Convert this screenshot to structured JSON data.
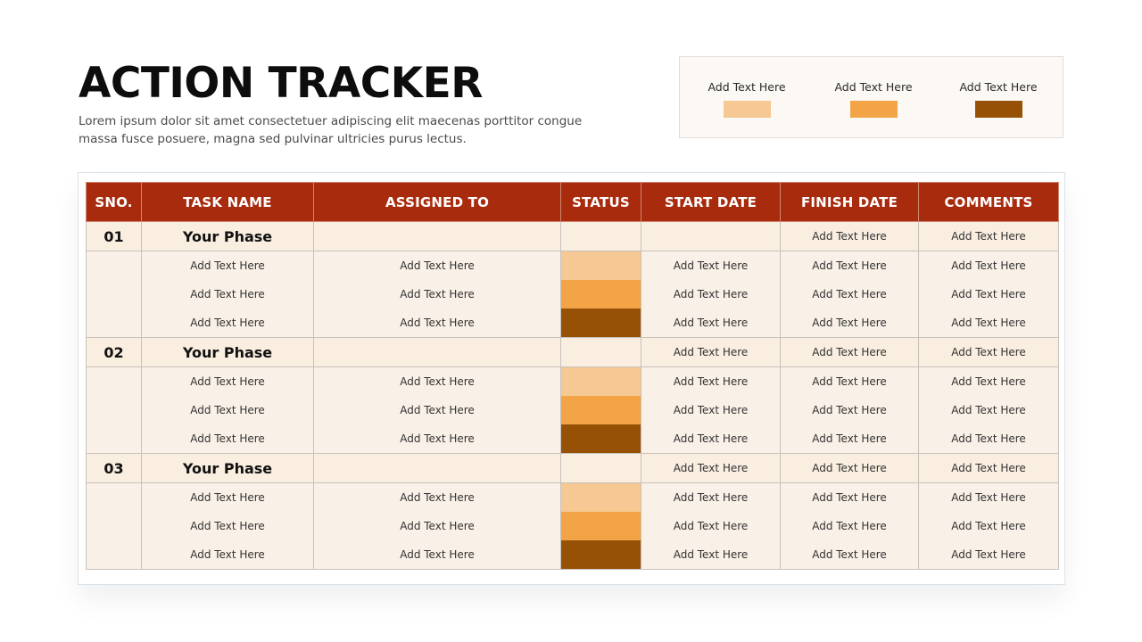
{
  "header": {
    "title": "ACTION TRACKER",
    "subtitle": "Lorem ipsum dolor sit amet consectetuer adipiscing elit maecenas porttitor congue massa fusce posuere, magna sed pulvinar ultricies purus lectus."
  },
  "legend": [
    {
      "label": "Add Text Here",
      "color": "#f6c893"
    },
    {
      "label": "Add Text Here",
      "color": "#f2a446"
    },
    {
      "label": "Add Text Here",
      "color": "#965107"
    }
  ],
  "table": {
    "headers": [
      "SNO.",
      "TASK NAME",
      "ASSIGNED TO",
      "STATUS",
      "START DATE",
      "FINISH DATE",
      "COMMENTS"
    ],
    "phases": [
      {
        "sno": "01",
        "name": "Your Phase",
        "start": "",
        "finish": "Add Text Here",
        "comments": "Add Text Here",
        "tasks": [
          {
            "task": "Add Text Here",
            "assigned": "Add Text Here",
            "status_color": "#f6c893",
            "start": "Add Text Here",
            "finish": "Add Text Here",
            "comments": "Add Text Here"
          },
          {
            "task": "Add Text Here",
            "assigned": "Add Text Here",
            "status_color": "#f2a446",
            "start": "Add Text Here",
            "finish": "Add Text Here",
            "comments": "Add Text Here"
          },
          {
            "task": "Add Text Here",
            "assigned": "Add Text Here",
            "status_color": "#965107",
            "start": "Add Text Here",
            "finish": "Add Text Here",
            "comments": "Add Text Here"
          }
        ]
      },
      {
        "sno": "02",
        "name": "Your Phase",
        "start": "Add Text Here",
        "finish": "Add Text Here",
        "comments": "Add Text Here",
        "tasks": [
          {
            "task": "Add Text Here",
            "assigned": "Add Text Here",
            "status_color": "#f6c893",
            "start": "Add Text Here",
            "finish": "Add Text Here",
            "comments": "Add Text Here"
          },
          {
            "task": "Add Text Here",
            "assigned": "Add Text Here",
            "status_color": "#f2a446",
            "start": "Add Text Here",
            "finish": "Add Text Here",
            "comments": "Add Text Here"
          },
          {
            "task": "Add Text Here",
            "assigned": "Add Text Here",
            "status_color": "#965107",
            "start": "Add Text Here",
            "finish": "Add Text Here",
            "comments": "Add Text Here"
          }
        ]
      },
      {
        "sno": "03",
        "name": "Your Phase",
        "start": "Add Text Here",
        "finish": "Add Text Here",
        "comments": "Add Text Here",
        "tasks": [
          {
            "task": "Add Text Here",
            "assigned": "Add Text Here",
            "status_color": "#f6c893",
            "start": "Add Text Here",
            "finish": "Add Text Here",
            "comments": "Add Text Here"
          },
          {
            "task": "Add Text Here",
            "assigned": "Add Text Here",
            "status_color": "#f2a446",
            "start": "Add Text Here",
            "finish": "Add Text Here",
            "comments": "Add Text Here"
          },
          {
            "task": "Add Text Here",
            "assigned": "Add Text Here",
            "status_color": "#965107",
            "start": "Add Text Here",
            "finish": "Add Text Here",
            "comments": "Add Text Here"
          }
        ]
      }
    ]
  }
}
